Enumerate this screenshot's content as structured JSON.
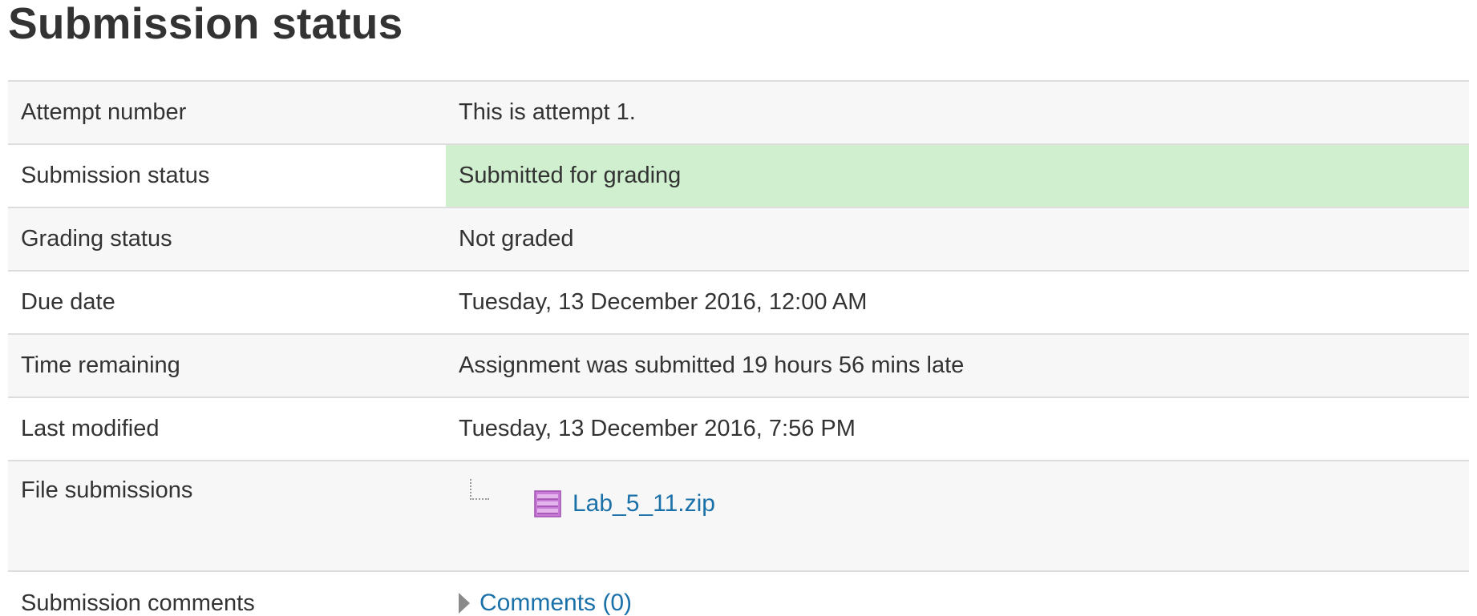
{
  "page": {
    "title": "Submission status"
  },
  "rows": {
    "attempt": {
      "label": "Attempt number",
      "value": "This is attempt 1."
    },
    "submission_status": {
      "label": "Submission status",
      "value": "Submitted for grading"
    },
    "grading_status": {
      "label": "Grading status",
      "value": "Not graded"
    },
    "due_date": {
      "label": "Due date",
      "value": "Tuesday, 13 December 2016, 12:00 AM"
    },
    "time_remaining": {
      "label": "Time remaining",
      "value": "Assignment was submitted 19 hours 56 mins late"
    },
    "last_modified": {
      "label": "Last modified",
      "value": "Tuesday, 13 December 2016, 7:56 PM"
    },
    "file_submissions": {
      "label": "File submissions",
      "file_name": "Lab_5_11.zip",
      "file_icon": "archive-icon"
    },
    "submission_comments": {
      "label": "Submission comments",
      "link_text": "Comments (0)"
    }
  },
  "colors": {
    "submitted_bg": "#cfefcf",
    "link": "#1a70a8",
    "row_alt": "#f7f7f7"
  }
}
